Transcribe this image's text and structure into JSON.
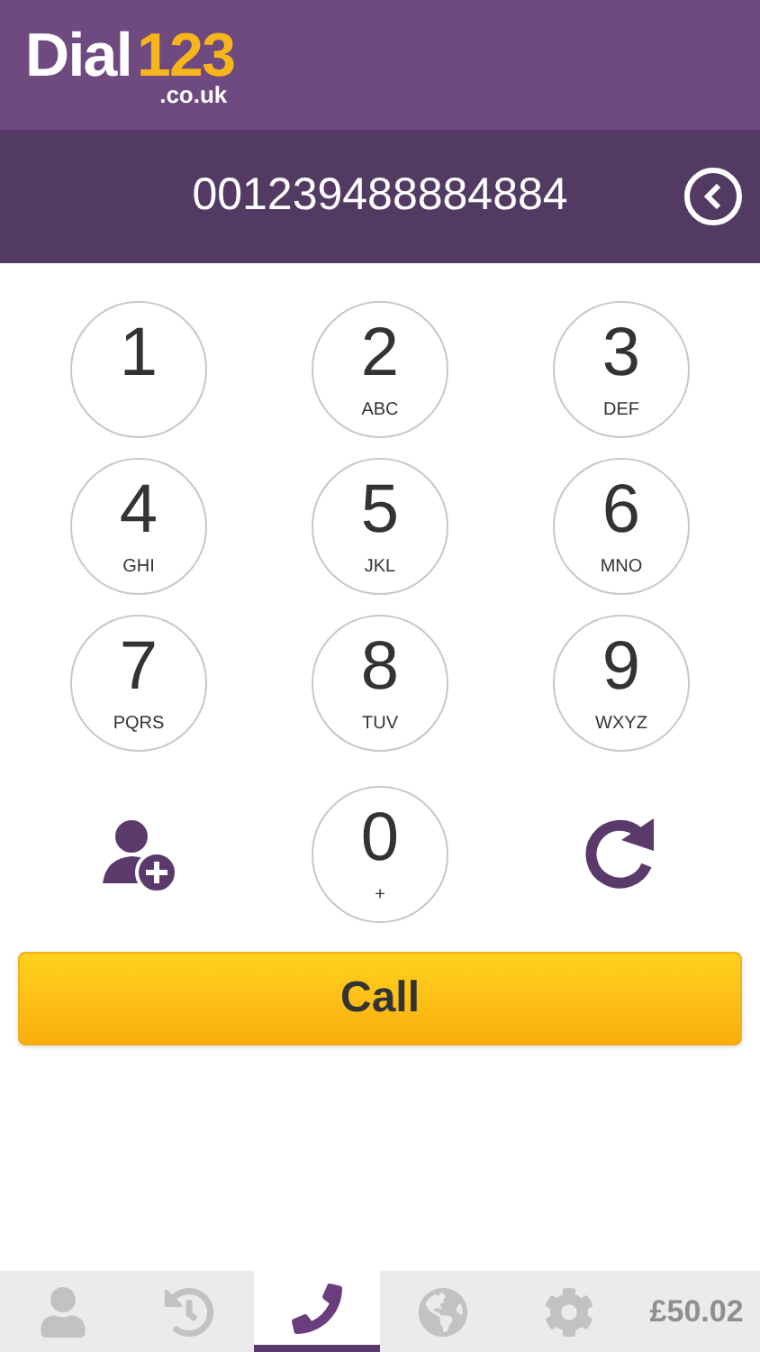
{
  "logo": {
    "word": "Dial",
    "number": "123",
    "domain": ".co.uk"
  },
  "dialed_number": "001239488884884",
  "keys": [
    {
      "kind": "digit",
      "digit": "1"
    },
    {
      "kind": "digit",
      "digit": "2",
      "letters": "ABC"
    },
    {
      "kind": "digit",
      "digit": "3",
      "letters": "DEF"
    },
    {
      "kind": "digit",
      "digit": "4",
      "letters": "GHI"
    },
    {
      "kind": "digit",
      "digit": "5",
      "letters": "JKL"
    },
    {
      "kind": "digit",
      "digit": "6",
      "letters": "MNO"
    },
    {
      "kind": "digit",
      "digit": "7",
      "letters": "PQRS"
    },
    {
      "kind": "digit",
      "digit": "8",
      "letters": "TUV"
    },
    {
      "kind": "digit",
      "digit": "9",
      "letters": "WXYZ"
    },
    {
      "kind": "add_contact"
    },
    {
      "kind": "digit",
      "digit": "0",
      "letters": "+"
    },
    {
      "kind": "redial"
    }
  ],
  "call_button": "Call",
  "nav": [
    {
      "kind": "contacts",
      "selected": false
    },
    {
      "kind": "history",
      "selected": false
    },
    {
      "kind": "dialer",
      "selected": true
    },
    {
      "kind": "rates",
      "selected": false
    },
    {
      "kind": "settings",
      "selected": false
    },
    {
      "kind": "balance",
      "label": "£50.02",
      "selected": false
    }
  ]
}
